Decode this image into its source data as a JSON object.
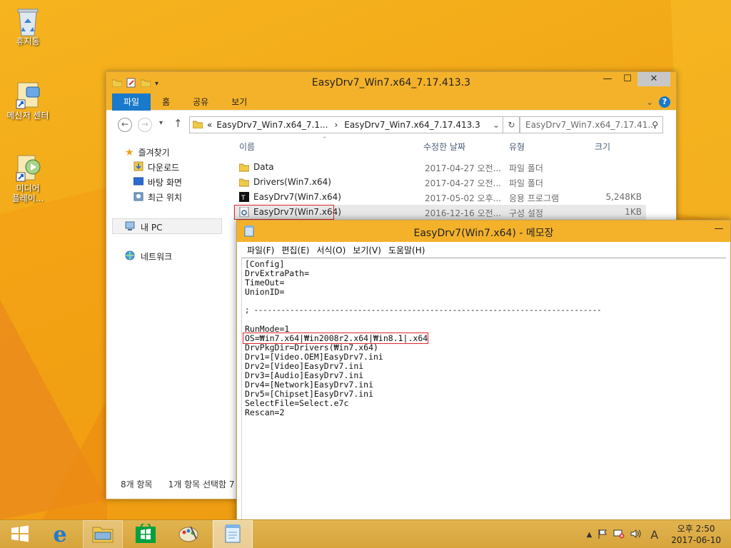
{
  "desktop": {
    "icons": [
      {
        "label": "휴지통",
        "icon": "recycle-bin-icon"
      },
      {
        "label": "메신저 센터",
        "icon": "messenger-center-icon"
      },
      {
        "label": "미디어",
        "label2": "플레이...",
        "icon": "media-player-icon"
      }
    ]
  },
  "explorer": {
    "title": "EasyDrv7_Win7.x64_7.17.413.3",
    "ribbon_tabs": [
      "파일",
      "홈",
      "공유",
      "보기"
    ],
    "address": {
      "overflow": "«",
      "crumb1": "EasyDrv7_Win7.x64_7.1...",
      "sep": "›",
      "crumb2": "EasyDrv7_Win7.x64_7.17.413.3"
    },
    "search_placeholder": "EasyDrv7_Win7.x64_7.17.41...",
    "nav": {
      "favorites": "즐겨찾기",
      "downloads": "다운로드",
      "desktop": "바탕 화면",
      "recent": "최근 위치",
      "this_pc": "내 PC",
      "network": "네트워크"
    },
    "columns": {
      "name": "이름",
      "date": "수정한 날짜",
      "type": "유형",
      "size": "크기"
    },
    "files": [
      {
        "name": "Data",
        "date": "2017-04-27 오전...",
        "type": "파일 폴더",
        "size": ""
      },
      {
        "name": "Drivers(Win7.x64)",
        "date": "2017-04-27 오전...",
        "type": "파일 폴더",
        "size": ""
      },
      {
        "name": "EasyDrv7(Win7.x64)",
        "date": "2017-05-02 오후...",
        "type": "응용 프로그램",
        "size": "5,248KB"
      },
      {
        "name": "EasyDrv7(Win7.x64)",
        "date": "2016-12-16 오전...",
        "type": "구성 설정",
        "size": "1KB"
      }
    ],
    "status": {
      "count": "8개 항목",
      "selected": "1개 항목 선택함 7"
    }
  },
  "notepad": {
    "title": "EasyDrv7(Win7.x64) - 메모장",
    "menu": [
      "파일(F)",
      "편집(E)",
      "서식(O)",
      "보기(V)",
      "도움말(H)"
    ],
    "lines": [
      "[Config]",
      "DrvExtraPath=",
      "TimeOut=",
      "UnionID=",
      "",
      "; -----------------------------------------------------------------------------",
      "",
      "RunMode=1",
      "OS=₩in7.x64|₩in2008r2.x64|₩in8.1|.x64",
      "DrvPkgDir=Drivers(₩in7.x64)",
      "Drv1=[Video.OEM]EasyDrv7.ini",
      "Drv2=[Video]EasyDrv7.ini",
      "Drv3=[Audio]EasyDrv7.ini",
      "Drv4=[Network]EasyDrv7.ini",
      "Drv5=[Chipset]EasyDrv7.ini",
      "SelectFile=Select.e7c",
      "Rescan=2"
    ]
  },
  "taskbar": {
    "ime": "A",
    "time": "오후 2:50",
    "date": "2017-06-10"
  },
  "colors": {
    "accent": "#1979ca",
    "frame": "#f4b22a",
    "highlight_box": "#e0262b"
  }
}
